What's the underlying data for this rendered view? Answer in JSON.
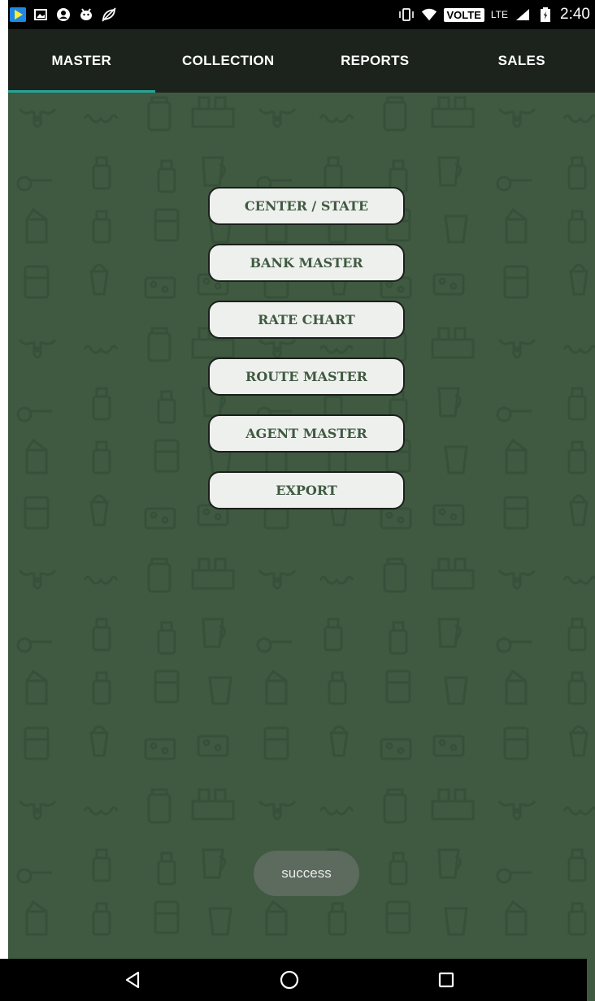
{
  "status_bar": {
    "left_icons": [
      "play-store-icon",
      "image-icon",
      "account-icon",
      "android-debug-icon",
      "no-sim-leaf-icon"
    ],
    "right_icons": [
      "vibrate-icon",
      "wifi-icon",
      "signal-icon",
      "battery-icon"
    ],
    "volte": "VOLTE",
    "lte": "LTE",
    "time": "2:40"
  },
  "tabs": [
    {
      "label": "MASTER",
      "active": true
    },
    {
      "label": "COLLECTION",
      "active": false
    },
    {
      "label": "REPORTS",
      "active": false
    },
    {
      "label": "SALES",
      "active": false
    }
  ],
  "menu": [
    {
      "label": "CENTER / STATE"
    },
    {
      "label": "BANK MASTER"
    },
    {
      "label": "RATE CHART"
    },
    {
      "label": "ROUTE MASTER"
    },
    {
      "label": "AGENT MASTER"
    },
    {
      "label": "EXPORT"
    }
  ],
  "toast": "success",
  "colors": {
    "background": "#3f5a40",
    "tab_bar": "#1c231c",
    "tab_indicator": "#26a69a",
    "button_bg": "#eef0ee",
    "button_text": "#3f5a40"
  },
  "nav": [
    "back-icon",
    "home-icon",
    "recents-icon"
  ]
}
